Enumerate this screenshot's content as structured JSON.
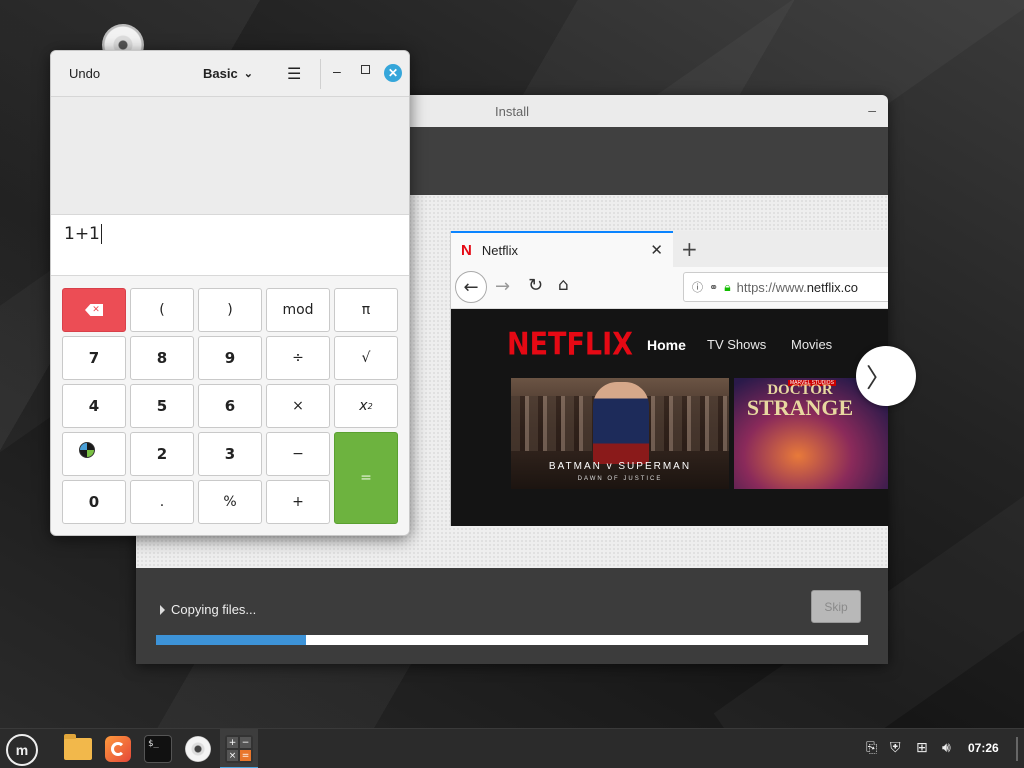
{
  "calculator": {
    "undo_label": "Undo",
    "mode_label": "Basic",
    "expression": "1+1",
    "keys": {
      "lparen": "(",
      "rparen": ")",
      "mod": "mod",
      "pi": "π",
      "seven": "7",
      "eight": "8",
      "nine": "9",
      "divide": "÷",
      "sqrt": "√",
      "four": "4",
      "five": "5",
      "six": "6",
      "multiply": "×",
      "square_base": "x",
      "square_exp": "2",
      "two": "2",
      "three": "3",
      "minus": "−",
      "equals": "=",
      "zero": "0",
      "decimal": ".",
      "percent": "%",
      "plus": "+"
    }
  },
  "installer": {
    "title": "Install",
    "status": "Copying files...",
    "skip_label": "Skip",
    "progress_fraction": 0.21
  },
  "browser_slide": {
    "tab_title": "Netflix",
    "tab_favicon": "N",
    "url_text": "https://www.",
    "url_domain": "netflix.co",
    "logo": "NETFLIX",
    "nav": [
      "Home",
      "TV Shows",
      "Movies"
    ],
    "poster1_title": "BATMAN v SUPERMAN",
    "poster1_subtitle": "DAWN OF JUSTICE",
    "poster2_brand": "MARVEL STUDIOS",
    "poster2_title_top": "DOCTOR",
    "poster2_title_bottom": "STRANGE"
  },
  "taskbar": {
    "menu_icon": "linux-mint-icon",
    "terminal_prompt": "$_",
    "clock": "07:26"
  },
  "colors": {
    "accent": "#3d93d8",
    "equals_green": "#6db33f",
    "backspace_red": "#ec4d55",
    "netflix_red": "#e50914"
  }
}
